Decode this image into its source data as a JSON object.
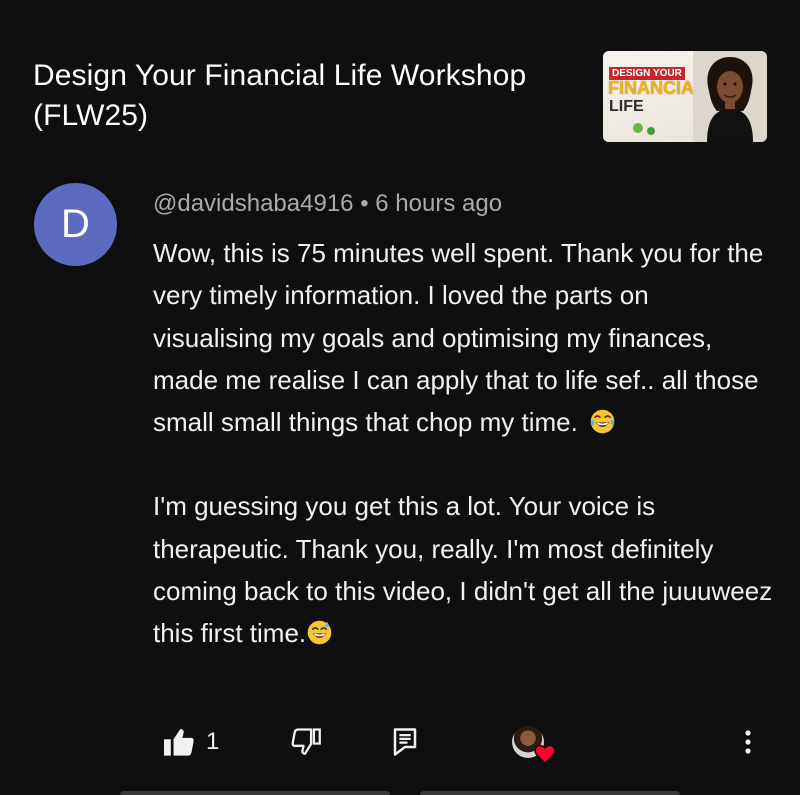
{
  "video": {
    "title": "Design Your Financial Life Workshop (FLW25)",
    "thumbnail": {
      "line1": "DESIGN YOUR",
      "line2": "FINANCIAL",
      "line3": "LIFE"
    }
  },
  "comment": {
    "avatar_initial": "D",
    "author": "@davidshaba4916",
    "separator": " • ",
    "time": "6 hours ago",
    "paragraph1": "Wow, this is 75 minutes well spent. Thank you for the very timely information. I loved the parts on visualising my goals and optimising my finances, made me realise I can apply that to life sef.. all those small small things that chop my time. ",
    "paragraph2": "I'm guessing you get this a lot. Your voice is therapeutic. Thank you, really. I'm most definitely coming back to this video, I didn't get all the juuuweez this first time.",
    "avatar_color": "#5c6bc0"
  },
  "actions": {
    "like_count": "1",
    "like_icon": "thumbs-up-icon",
    "dislike_icon": "thumbs-down-icon",
    "reply_icon": "reply-icon",
    "heart_icon": "creator-heart-icon",
    "more_icon": "more-vertical-icon",
    "heart_color": "#ff0033"
  },
  "theme": {
    "background": "#0f0f0f",
    "text": "#f1f1f1",
    "secondary_text": "#aaaaaa"
  }
}
